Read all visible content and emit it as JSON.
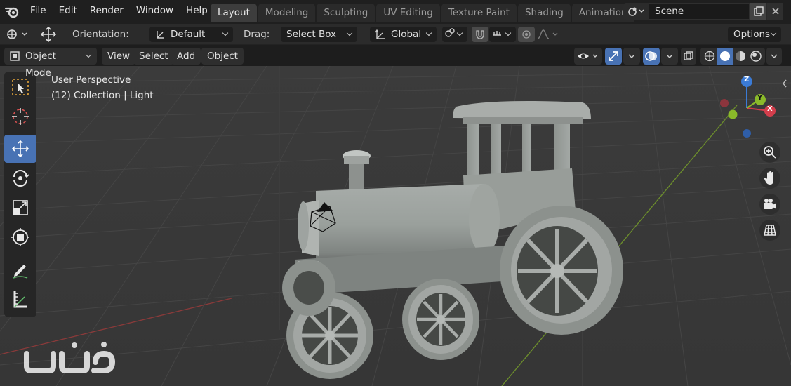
{
  "menu": [
    "File",
    "Edit",
    "Render",
    "Window",
    "Help"
  ],
  "workspace_tabs": [
    "Layout",
    "Modeling",
    "Sculpting",
    "UV Editing",
    "Texture Paint",
    "Shading",
    "Animation"
  ],
  "active_tab": "Layout",
  "scene": {
    "value": "Scene"
  },
  "toolbar": {
    "orientation_label": "Orientation:",
    "orientation_value": "Default",
    "drag_label": "Drag:",
    "drag_value": "Select Box",
    "transform_orientation": "Global",
    "options_label": "Options"
  },
  "viewport_header": {
    "mode": "Object Mode",
    "view": "View",
    "select": "Select",
    "add": "Add",
    "object": "Object"
  },
  "viewport_info": {
    "perspective": "User Perspective",
    "collection": "(12) Collection | Light"
  },
  "gizmo": {
    "x": "X",
    "y": "Y",
    "z": "Z"
  },
  "colors": {
    "accent_blue": "#4872b4",
    "axis_x": "#d33e4c",
    "axis_y": "#8aba2a",
    "axis_z": "#3b7bd6",
    "model_gray": "#9aa09c"
  },
  "watermark_text": "ناص"
}
